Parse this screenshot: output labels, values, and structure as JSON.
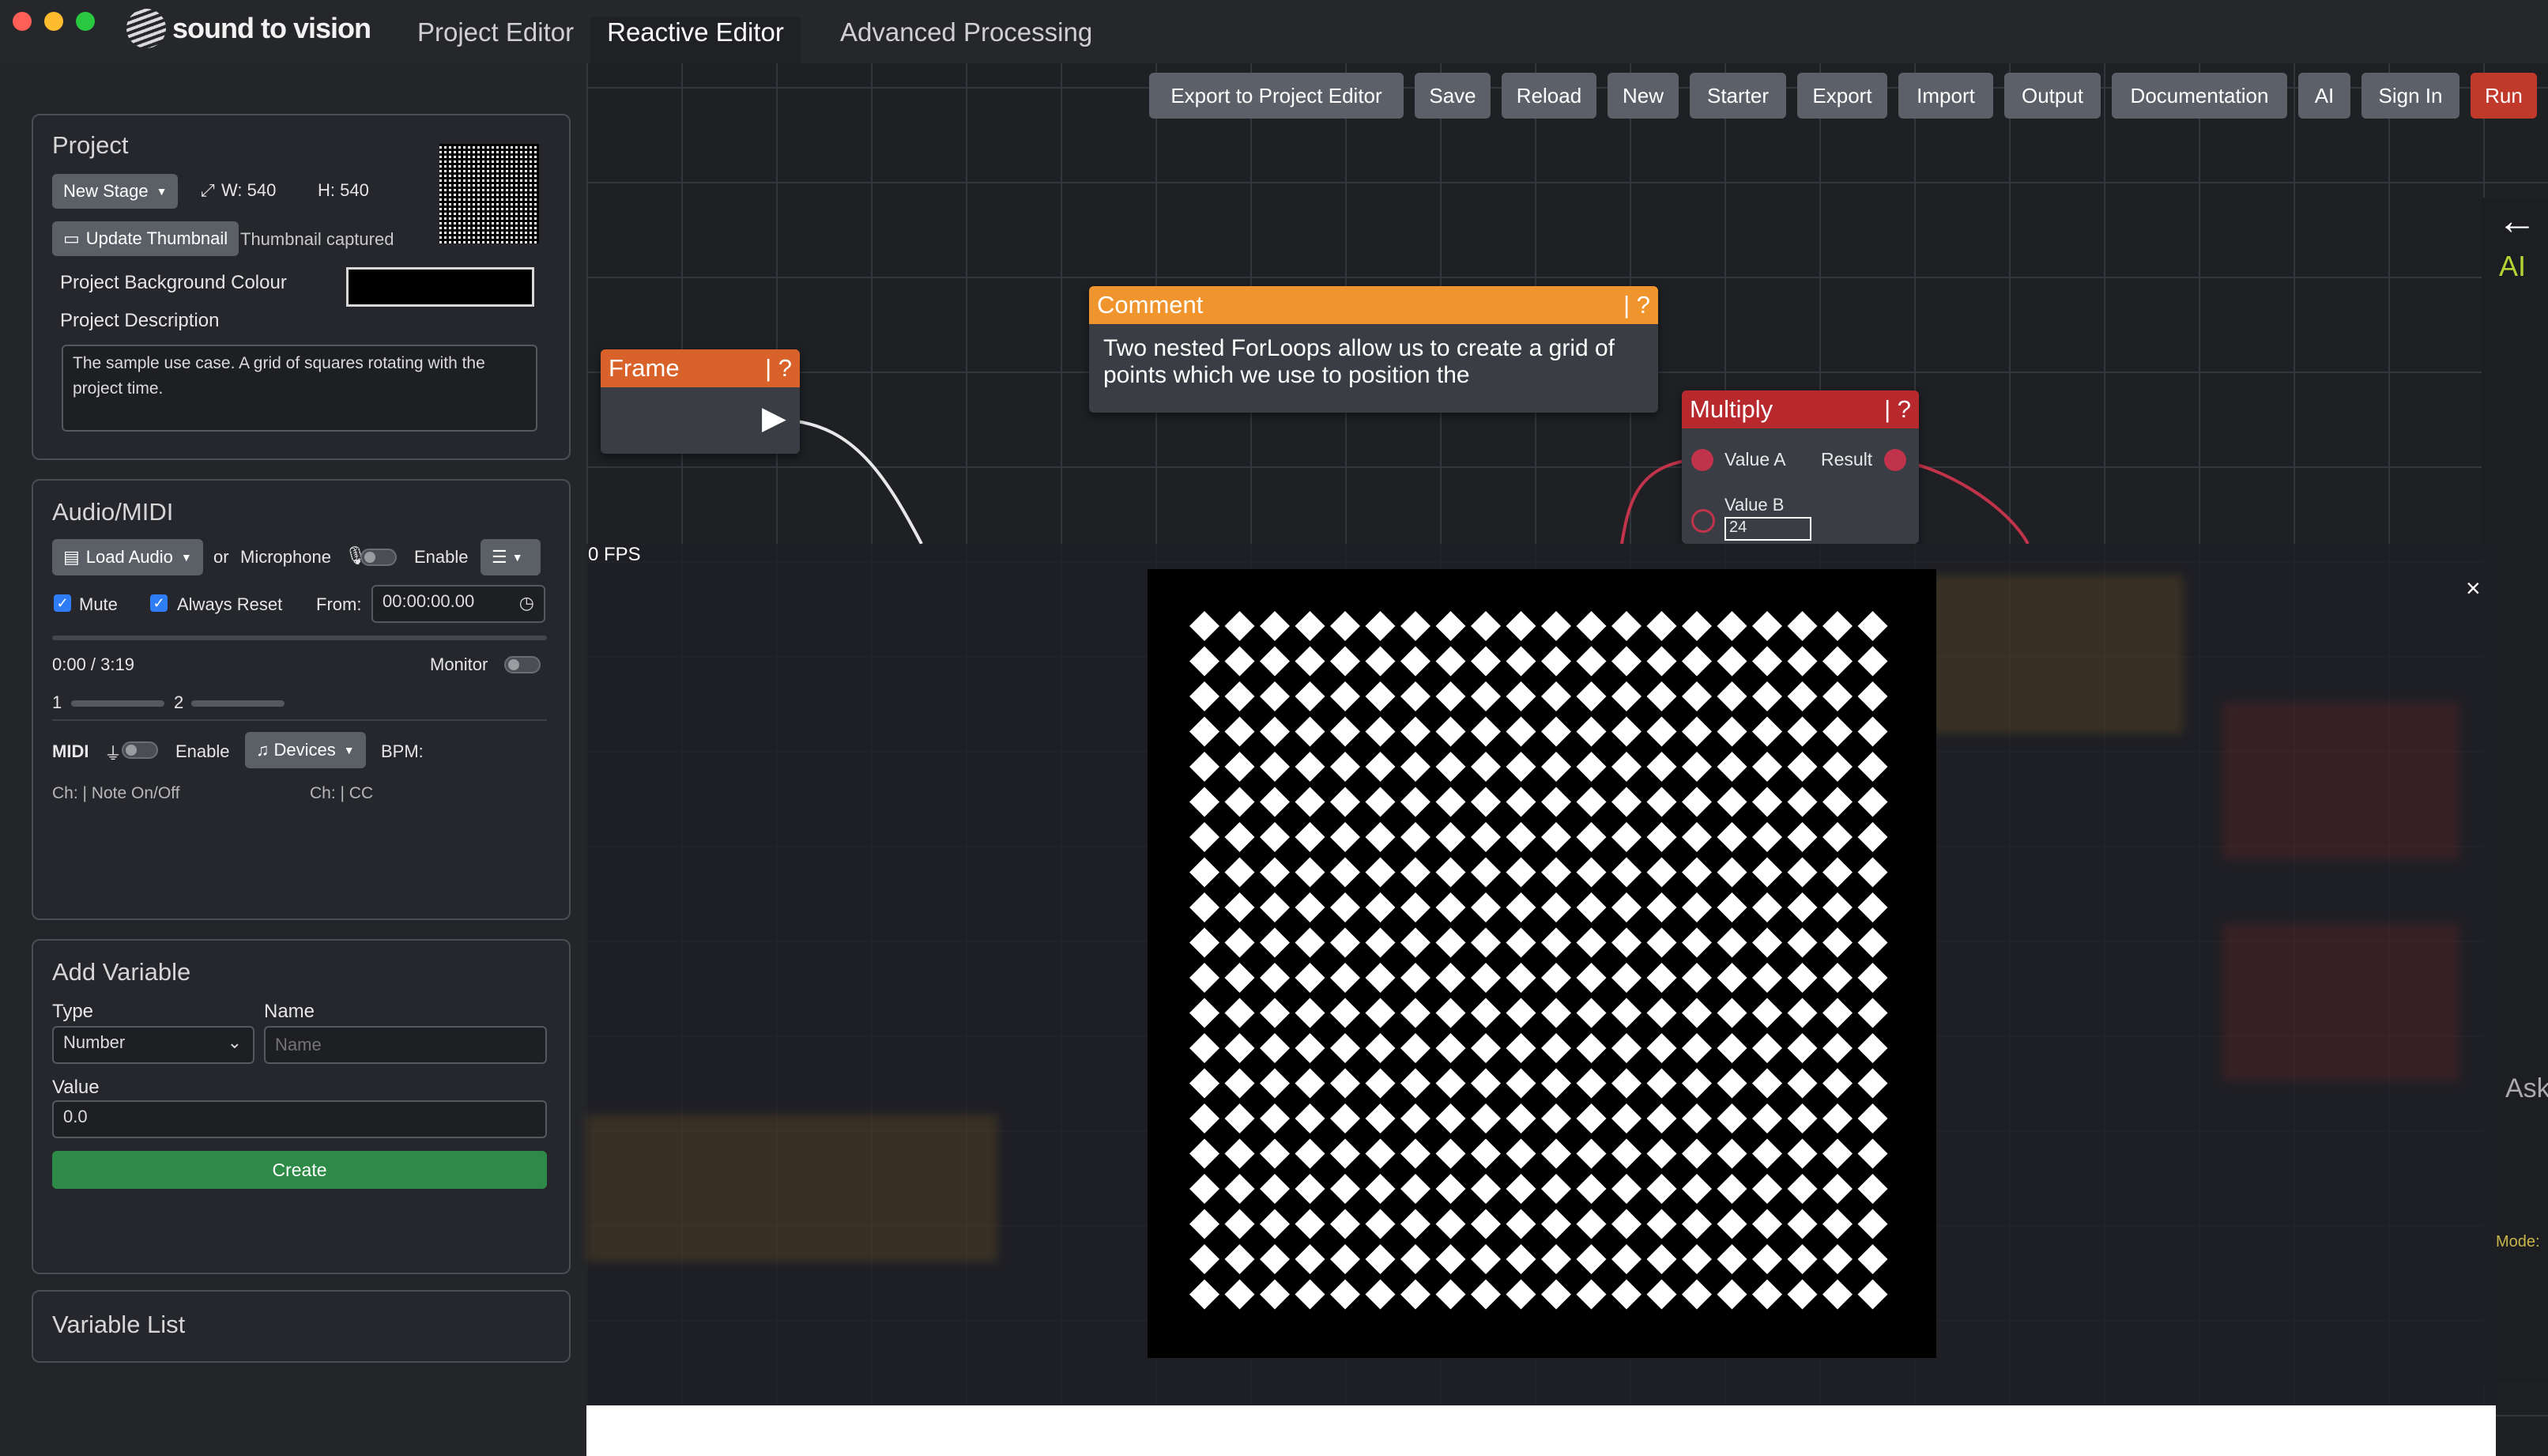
{
  "app": {
    "name": "sound to vision",
    "tabs": [
      "Project Editor",
      "Reactive Editor",
      "Advanced Processing"
    ],
    "active_tab": "Reactive Editor"
  },
  "toolbar": [
    "Export to Project Editor",
    "Save",
    "Reload",
    "New",
    "Starter",
    "Export",
    "Import",
    "Output",
    "Documentation",
    "AI",
    "Sign In",
    "Run"
  ],
  "project": {
    "title": "Project",
    "stage_button": "New Stage",
    "width_label": "W: 540",
    "height_label": "H: 540",
    "update_thumbnail": "Update Thumbnail",
    "thumbnail_status": "Thumbnail captured",
    "bg_colour_label": "Project Background Colour",
    "description_label": "Project Description",
    "description": "The sample use case. A grid of squares rotating with the project time."
  },
  "audio": {
    "title": "Audio/MIDI",
    "load_audio": "Load Audio",
    "or": "or",
    "microphone": "Microphone",
    "enable": "Enable",
    "mute": "Mute",
    "always_reset": "Always Reset",
    "from_label": "From:",
    "from_value": "00:00:00.00",
    "time": "0:00 / 3:19",
    "monitor": "Monitor",
    "ch1": "1",
    "ch2": "2",
    "midi": "MIDI",
    "midi_enable": "Enable",
    "devices": "Devices",
    "bpm": "BPM:",
    "note_label": "Ch: | Note On/Off",
    "cc_label": "Ch: | CC"
  },
  "variable": {
    "title": "Add Variable",
    "type_label": "Type",
    "type_value": "Number",
    "name_label": "Name",
    "name_placeholder": "Name",
    "value_label": "Value",
    "value": "0.0",
    "create": "Create",
    "list_title": "Variable List"
  },
  "nodes": {
    "comment_title": "Comment",
    "comment_help": "| ?",
    "comment_text": "Two nested ForLoops allow us to create a grid of points which we use to position the",
    "frame_title": "Frame",
    "frame_help": "| ?",
    "multiply_title": "Multiply",
    "multiply_help": "| ?",
    "value_a": "Value A",
    "result": "Result",
    "value_b": "Value B",
    "value_b_input": "24"
  },
  "preview": {
    "fps": "0 FPS",
    "close": "×"
  },
  "side_right": {
    "ai": "AI",
    "ask": "Ask",
    "mode": "Mode:"
  },
  "colors": {
    "run": "#c0392b",
    "create": "#2e8b47",
    "comment": "#f0952e",
    "frame": "#d9622b",
    "multiply": "#b8292e"
  }
}
